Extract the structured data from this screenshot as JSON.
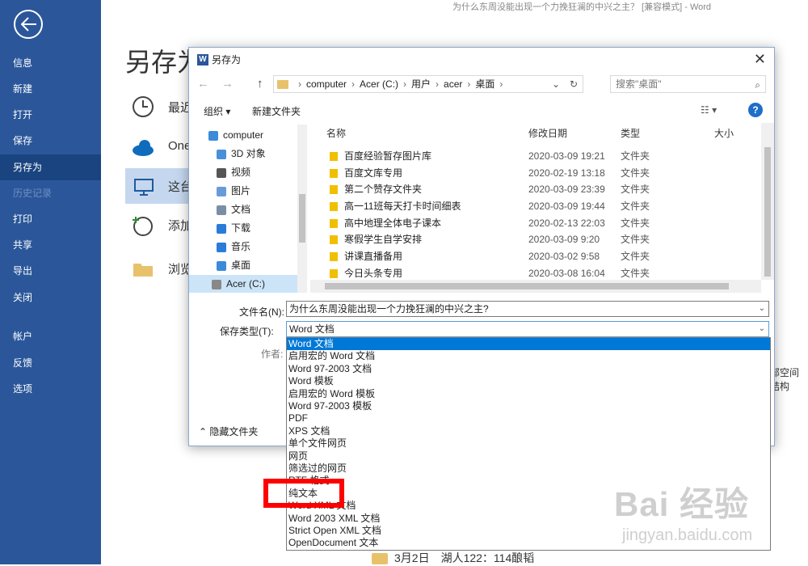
{
  "window": {
    "title": "为什么东周没能出现一个力挽狂澜的中兴之主？ [兼容模式] - Word"
  },
  "leftnav": {
    "items": [
      {
        "label": "信息"
      },
      {
        "label": "新建"
      },
      {
        "label": "打开"
      },
      {
        "label": "保存"
      },
      {
        "label": "另存为"
      },
      {
        "label": "历史记录"
      },
      {
        "label": "打印"
      },
      {
        "label": "共享"
      },
      {
        "label": "导出"
      },
      {
        "label": "关闭"
      },
      {
        "label": "帐户"
      },
      {
        "label": "反馈"
      },
      {
        "label": "选项"
      }
    ]
  },
  "backstage": {
    "heading": "另存为",
    "locations": [
      {
        "label": "最近",
        "icon": "clock-icon"
      },
      {
        "label": "One",
        "icon": "onedrive-icon"
      },
      {
        "label": "这台",
        "icon": "computer-icon"
      },
      {
        "label": "添加",
        "icon": "add-place-icon"
      },
      {
        "label": "浏览",
        "icon": "folder-icon"
      }
    ],
    "folder_row": "3月2日　湖人122：114酿韬",
    "side_text": "部空间结构"
  },
  "dialog": {
    "title": "另存为",
    "address": [
      "computer",
      "Acer (C:)",
      "用户",
      "acer",
      "桌面"
    ],
    "search_placeholder": "搜索\"桌面\"",
    "organize_label": "组织 ▾",
    "new_folder_label": "新建文件夹",
    "tree": [
      {
        "label": "computer",
        "color": "#3c8bd9"
      },
      {
        "label": "3D 对象",
        "color": "#4a90d9"
      },
      {
        "label": "视频",
        "color": "#555555"
      },
      {
        "label": "图片",
        "color": "#6a9bd9"
      },
      {
        "label": "文档",
        "color": "#7a8fa6"
      },
      {
        "label": "下载",
        "color": "#2b7bd9"
      },
      {
        "label": "音乐",
        "color": "#2b7bd9"
      },
      {
        "label": "桌面",
        "color": "#3c8bd9"
      },
      {
        "label": "Acer (C:)",
        "color": "#888888"
      }
    ],
    "columns": {
      "name": "名称",
      "date": "修改日期",
      "type": "类型",
      "size": "大小"
    },
    "files": [
      {
        "name": "百度经验暂存图片库",
        "date": "2020-03-09 19:21",
        "type": "文件夹"
      },
      {
        "name": "百度文库专用",
        "date": "2020-02-19 13:18",
        "type": "文件夹"
      },
      {
        "name": "第二个赞存文件夹",
        "date": "2020-03-09 23:39",
        "type": "文件夹"
      },
      {
        "name": "高一11班每天打卡时间细表",
        "date": "2020-03-09 19:44",
        "type": "文件夹"
      },
      {
        "name": "高中地理全体电子课本",
        "date": "2020-02-13 22:03",
        "type": "文件夹"
      },
      {
        "name": "寒假学生自学安排",
        "date": "2020-03-09 9:20",
        "type": "文件夹"
      },
      {
        "name": "讲课直播备用",
        "date": "2020-03-02 9:58",
        "type": "文件夹"
      },
      {
        "name": "今日头条专用",
        "date": "2020-03-08 16:04",
        "type": "文件夹"
      }
    ],
    "filename_label": "文件名(N):",
    "filename_value": "为什么东周没能出现一个力挽狂澜的中兴之主?",
    "savetype_label": "保存类型(T):",
    "savetype_value": "Word 文档",
    "author_label": "作者:",
    "hide_folders_label": "隐藏文件夹",
    "type_options": [
      "Word 文档",
      "启用宏的 Word 文档",
      "Word 97-2003 文档",
      "Word 模板",
      "启用宏的 Word 模板",
      "Word 97-2003 模板",
      "PDF",
      "XPS 文档",
      "单个文件网页",
      "网页",
      "筛选过的网页",
      "RTF 格式",
      "纯文本",
      "Word XML 文档",
      "Word 2003 XML 文档",
      "Strict Open XML 文档",
      "OpenDocument 文本"
    ]
  },
  "watermark": {
    "main": "Bai 经验",
    "sub": "jingyan.baidu.com"
  },
  "colors": {
    "nav_bg": "#2b579a",
    "nav_active": "#1a447f",
    "highlight": "#0078d7",
    "annotation": "#ff0000"
  }
}
